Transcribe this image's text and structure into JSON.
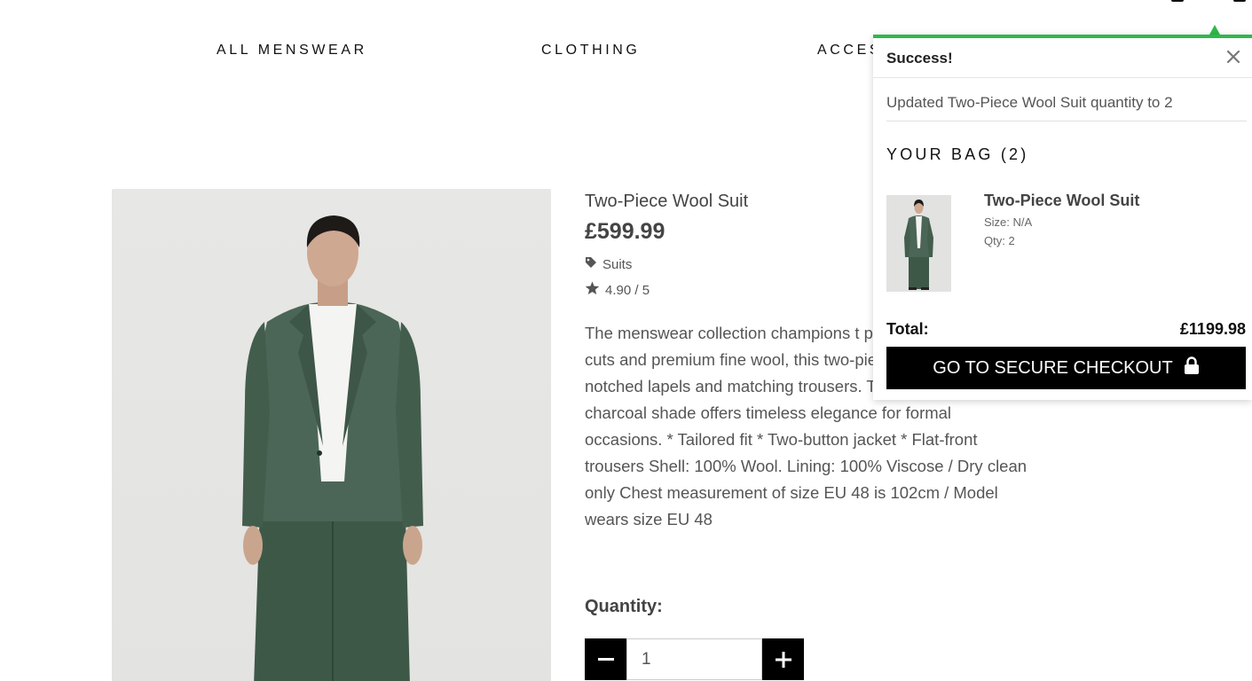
{
  "header": {
    "icons": [
      "account-icon",
      "bag-icon"
    ]
  },
  "nav": {
    "items": [
      {
        "label": "ALL MENSWEAR"
      },
      {
        "label": "CLOTHING"
      },
      {
        "label": "ACCES"
      }
    ]
  },
  "product": {
    "name": "Two-Piece Wool Suit",
    "price": "£599.99",
    "category": "Suits",
    "category_icon": "tag-icon",
    "rating": "4.90 / 5",
    "rating_icon": "star-icon",
    "description": "The menswear collection champions t pillars of perfected cuts and premium fine wool, this two-piece suit features with notched lapels and matching trousers. The sophisticated charcoal shade offers timeless elegance for formal occasions. * Tailored fit * Two-button jacket * Flat-front trousers Shell: 100% Wool. Lining: 100% Viscose / Dry clean only Chest measurement of size EU 48 is 102cm / Model wears size EU 48",
    "quantity_label": "Quantity:",
    "quantity_value": "1"
  },
  "toast": {
    "title": "Success!",
    "message": "Updated Two-Piece Wool Suit quantity to 2",
    "accent_color": "#2eb84b",
    "bag": {
      "heading": "YOUR BAG (2)",
      "items": [
        {
          "name": "Two-Piece Wool Suit",
          "size": "Size: N/A",
          "qty": "Qty: 2"
        }
      ],
      "total_label": "Total:",
      "total_value": "£1199.98",
      "checkout_label": "GO TO SECURE CHECKOUT",
      "checkout_icon": "lock-icon"
    }
  }
}
